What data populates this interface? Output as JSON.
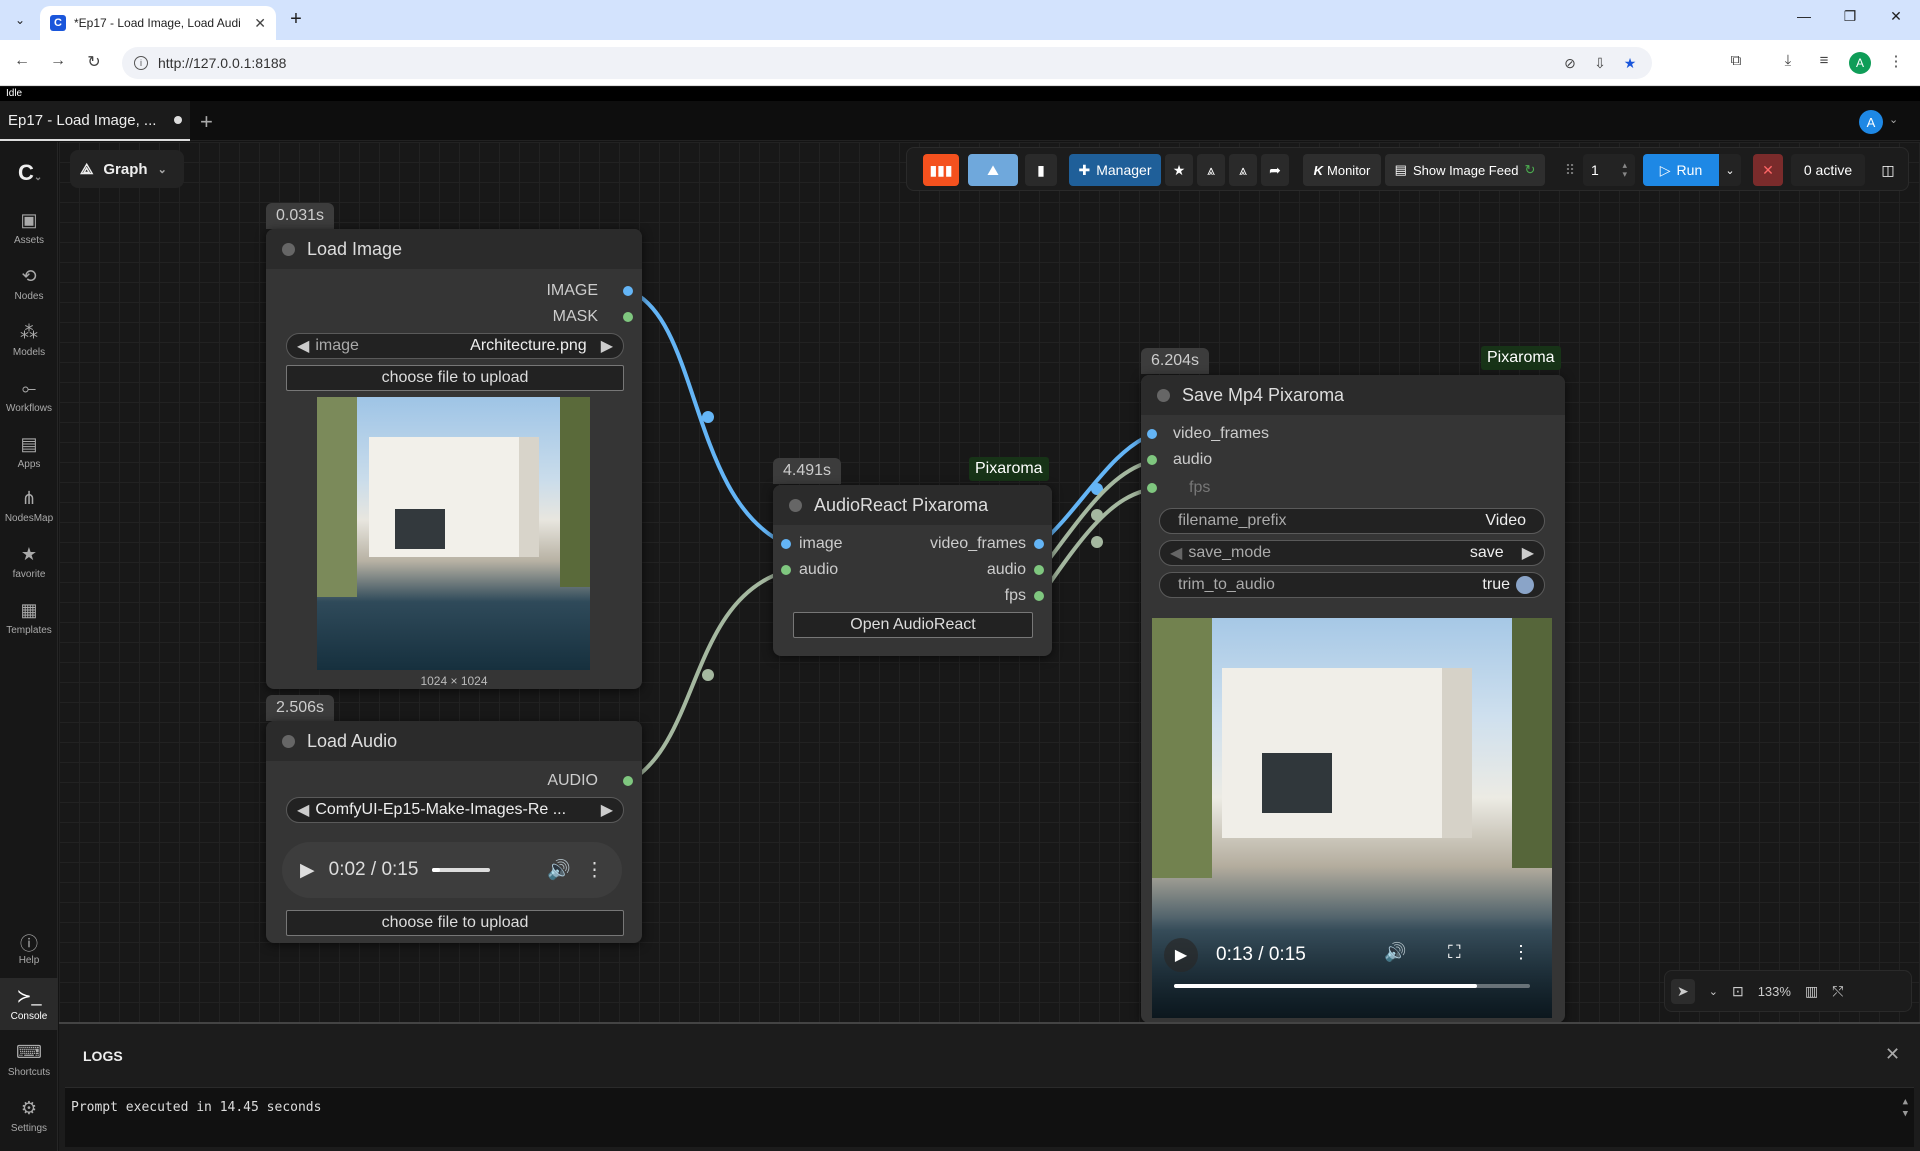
{
  "browser": {
    "tab_title": "*Ep17 - Load Image, Load Audi",
    "url": "http://127.0.0.1:8188",
    "profile_initial": "A"
  },
  "app": {
    "status": "Idle",
    "workflow_tab": "Ep17 - Load Image, ...",
    "user_initial": "A",
    "graph_label": "Graph"
  },
  "sidebar": {
    "items": [
      {
        "label": "Assets",
        "icon": "image-icon"
      },
      {
        "label": "Nodes",
        "icon": "nodes-icon"
      },
      {
        "label": "Models",
        "icon": "models-icon"
      },
      {
        "label": "Workflows",
        "icon": "workflows-icon"
      },
      {
        "label": "Apps",
        "icon": "apps-icon"
      },
      {
        "label": "NodesMap",
        "icon": "nodesmap-icon"
      },
      {
        "label": "favorite",
        "icon": "star-icon"
      },
      {
        "label": "Templates",
        "icon": "templates-icon"
      }
    ],
    "bottom": [
      {
        "label": "Help",
        "icon": "help-icon"
      },
      {
        "label": "Console",
        "icon": "console-icon"
      },
      {
        "label": "Shortcuts",
        "icon": "keyboard-icon"
      },
      {
        "label": "Settings",
        "icon": "gear-icon"
      }
    ]
  },
  "toolbar": {
    "manager": "Manager",
    "monitor": "Monitor",
    "monitor_prefix": "K",
    "show_feed": "Show Image Feed",
    "batch_count": "1",
    "run": "Run",
    "active": "0 active",
    "zoom": "133%"
  },
  "nodes": {
    "load_image": {
      "time": "0.031s",
      "title": "Load Image",
      "outputs": [
        "IMAGE",
        "MASK"
      ],
      "image_widget_label": "image",
      "image_widget_value": "Architecture.png",
      "upload": "choose file to upload",
      "dims": "1024 × 1024"
    },
    "load_audio": {
      "time": "2.506s",
      "title": "Load Audio",
      "output": "AUDIO",
      "audio_value": "ComfyUI-Ep15-Make-Images-Re ...",
      "player_time": "0:02 / 0:15",
      "player_progress": 0.13,
      "upload": "choose file to upload"
    },
    "audioreact": {
      "time": "4.491s",
      "badge": "Pixaroma",
      "title": "AudioReact Pixaroma",
      "inputs": [
        "image",
        "audio"
      ],
      "outputs": [
        "video_frames",
        "audio",
        "fps"
      ],
      "button": "Open AudioReact"
    },
    "savemp4": {
      "time": "6.204s",
      "badge": "Pixaroma",
      "title": "Save Mp4 Pixaroma",
      "inputs": [
        "video_frames",
        "audio",
        "fps"
      ],
      "filename_prefix_label": "filename_prefix",
      "filename_prefix_value": "Video",
      "save_mode_label": "save_mode",
      "save_mode_value": "save",
      "trim_label": "trim_to_audio",
      "trim_value": "true",
      "video_time": "0:13 / 0:15",
      "video_progress": 0.85
    }
  },
  "logs": {
    "title": "LOGS",
    "line": "Prompt executed in 14.45 seconds"
  },
  "colors": {
    "image_link": "#64b5f6",
    "audio_link": "#a5b8a0",
    "int_link": "#7fa070",
    "run_blue": "#1e88e5",
    "accent_orange": "#f4511e",
    "pixaroma_green": "#173317"
  }
}
